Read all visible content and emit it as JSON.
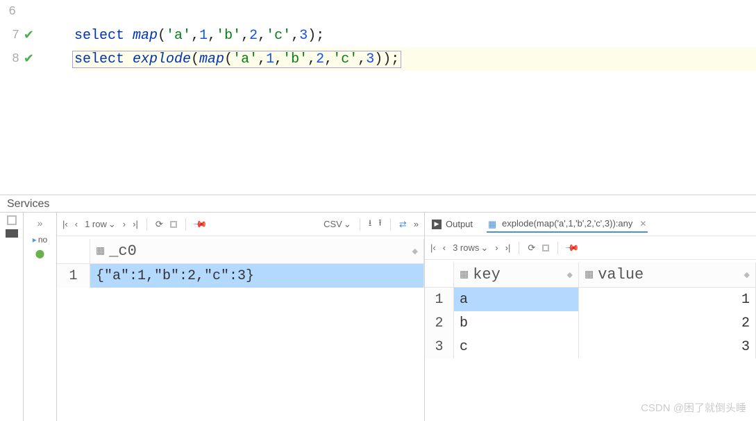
{
  "editor": {
    "lines": [
      {
        "num": "6",
        "check": false,
        "tokens": []
      },
      {
        "num": "7",
        "check": true
      },
      {
        "num": "8",
        "check": true,
        "current": true
      }
    ],
    "line7": {
      "kw": "select ",
      "fn": "map",
      "open": "(",
      "args": "'a',1,'b',2,'c',3",
      "close": ");"
    },
    "line8": {
      "kw": "select ",
      "fn1": "explode",
      "open1": "(",
      "fn2": "map",
      "open2": "(",
      "args": "'a',1,'b',2,'c',3",
      "close": "));"
    }
  },
  "services_label": "Services",
  "left_toolbar": {
    "rows_label": "1 row",
    "csv_label": "CSV"
  },
  "left_result": {
    "col": "_c0",
    "rows": [
      {
        "n": "1",
        "v": "{\"a\":1,\"b\":2,\"c\":3}"
      }
    ]
  },
  "right_tabs": {
    "output": "Output",
    "explode": "explode(map('a',1,'b',2,'c',3)):any"
  },
  "right_toolbar": {
    "rows_label": "3 rows"
  },
  "right_result": {
    "col1": "key",
    "col2": "value",
    "rows": [
      {
        "n": "1",
        "k": "a",
        "v": "1"
      },
      {
        "n": "2",
        "k": "b",
        "v": "2"
      },
      {
        "n": "3",
        "k": "c",
        "v": "3"
      }
    ]
  },
  "side_tree": {
    "item": "no"
  },
  "watermark": "CSDN @困了就倒头睡"
}
